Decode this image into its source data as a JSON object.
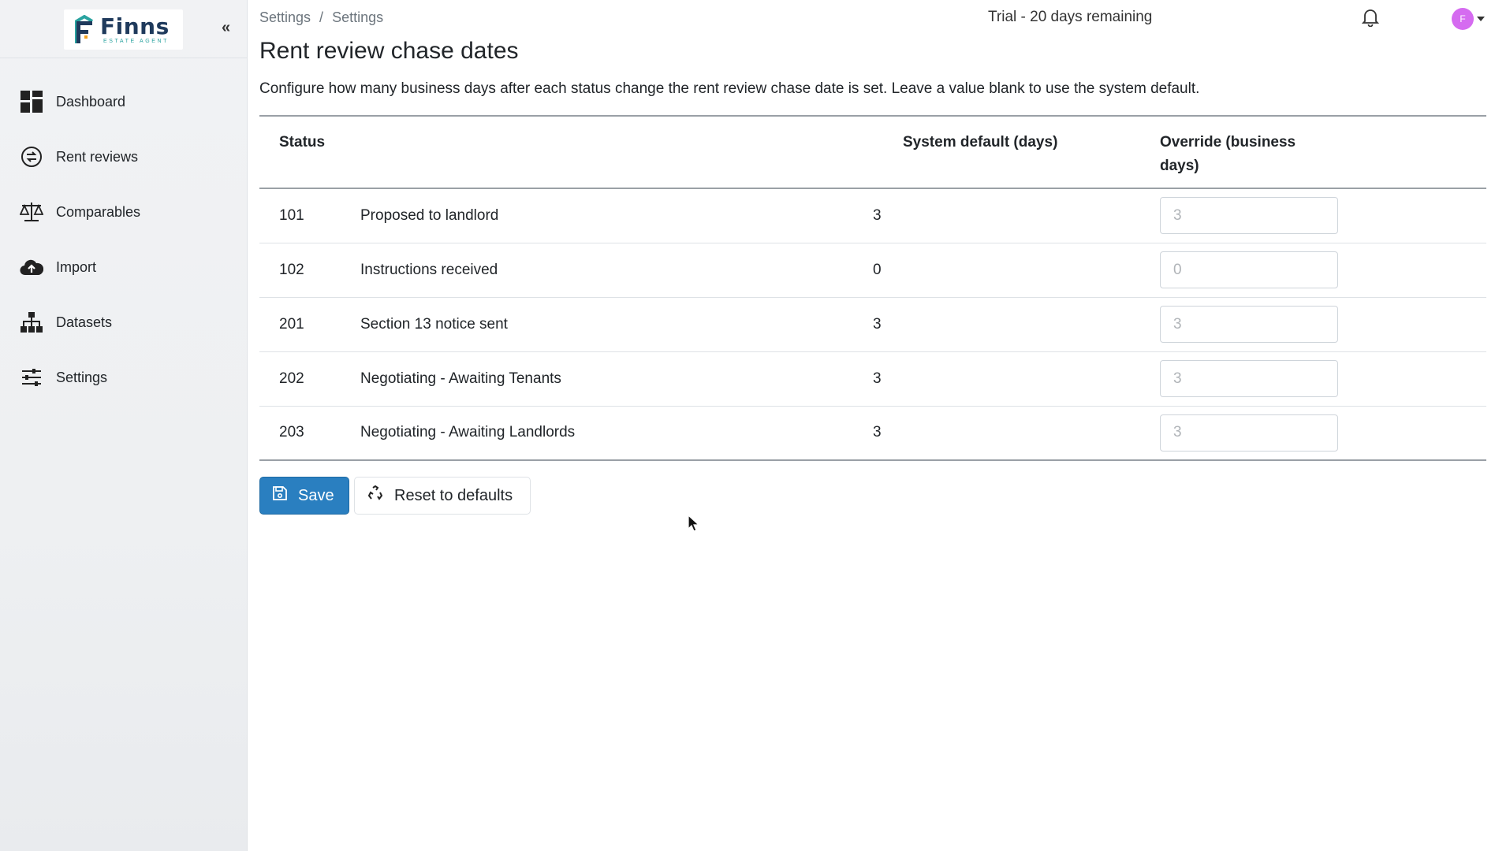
{
  "brand": {
    "name": "Finns",
    "tagline": "ESTATE AGENT"
  },
  "sidebar": {
    "collapse_label": "«",
    "items": [
      {
        "label": "Dashboard",
        "icon": "dashboard-icon"
      },
      {
        "label": "Rent reviews",
        "icon": "rent-reviews-icon"
      },
      {
        "label": "Comparables",
        "icon": "scales-icon"
      },
      {
        "label": "Import",
        "icon": "cloud-upload-icon"
      },
      {
        "label": "Datasets",
        "icon": "sitemap-icon"
      },
      {
        "label": "Settings",
        "icon": "sliders-icon"
      }
    ]
  },
  "header": {
    "breadcrumb": [
      "Settings",
      "Settings"
    ],
    "breadcrumb_sep": "/",
    "trial": "Trial - 20 days remaining",
    "avatar_initial": "F"
  },
  "page": {
    "title": "Rent review chase dates",
    "description": "Configure how many business days after each status change the rent review chase date is set. Leave a value blank to use the system default."
  },
  "table": {
    "headers": {
      "status": "Status",
      "default": "System default (days)",
      "override": "Override (business days)"
    },
    "rows": [
      {
        "code": "101",
        "label": "Proposed to landlord",
        "default": "3",
        "placeholder": "3"
      },
      {
        "code": "102",
        "label": "Instructions received",
        "default": "0",
        "placeholder": "0"
      },
      {
        "code": "201",
        "label": "Section 13 notice sent",
        "default": "3",
        "placeholder": "3"
      },
      {
        "code": "202",
        "label": "Negotiating - Awaiting Tenants",
        "default": "3",
        "placeholder": "3"
      },
      {
        "code": "203",
        "label": "Negotiating - Awaiting Landlords",
        "default": "3",
        "placeholder": "3"
      }
    ]
  },
  "actions": {
    "save": "Save",
    "reset": "Reset to defaults"
  },
  "colors": {
    "primary": "#2a7fc0",
    "avatar": "#d56bf0",
    "brand_navy": "#1f3a5c",
    "brand_teal": "#2aa3a0"
  }
}
